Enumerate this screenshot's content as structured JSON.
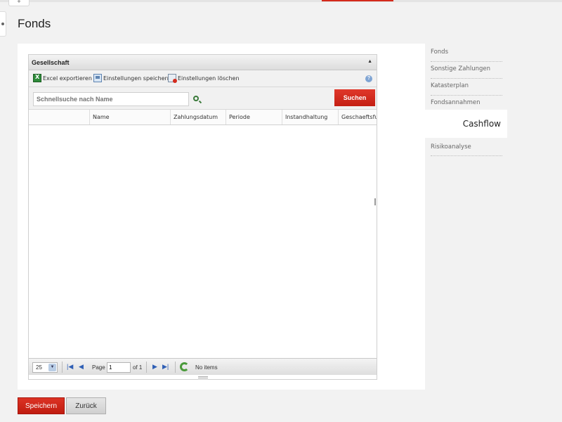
{
  "top": {
    "tab_glyph": "+"
  },
  "page": {
    "title": "Fonds"
  },
  "grid": {
    "title": "Gesellschaft",
    "collapse_glyph": "▲",
    "toolbar": {
      "export_label": "Excel exportieren",
      "save_settings_label": "Einstellungen speichern",
      "delete_settings_label": "Einstellungen löschen",
      "help_glyph": "?"
    },
    "search": {
      "placeholder": "Schnellsuche nach Name",
      "button_label": "Suchen"
    },
    "columns": [
      "",
      "Name",
      "Zahlungsdatum",
      "Periode",
      "Instandhaltung",
      "Geschaeftsfue"
    ],
    "pager": {
      "page_size": "25",
      "page_label": "Page",
      "page_value": "1",
      "of_label": "of 1",
      "status": "No items"
    }
  },
  "right_nav": {
    "items": [
      "Fonds",
      "Sonstige Zahlungen",
      "Katasterplan",
      "Fondsannahmen"
    ],
    "active": "Cashflow",
    "after": [
      "Risikoanalyse"
    ]
  },
  "actions": {
    "save_label": "Speichern",
    "back_label": "Zurück"
  }
}
